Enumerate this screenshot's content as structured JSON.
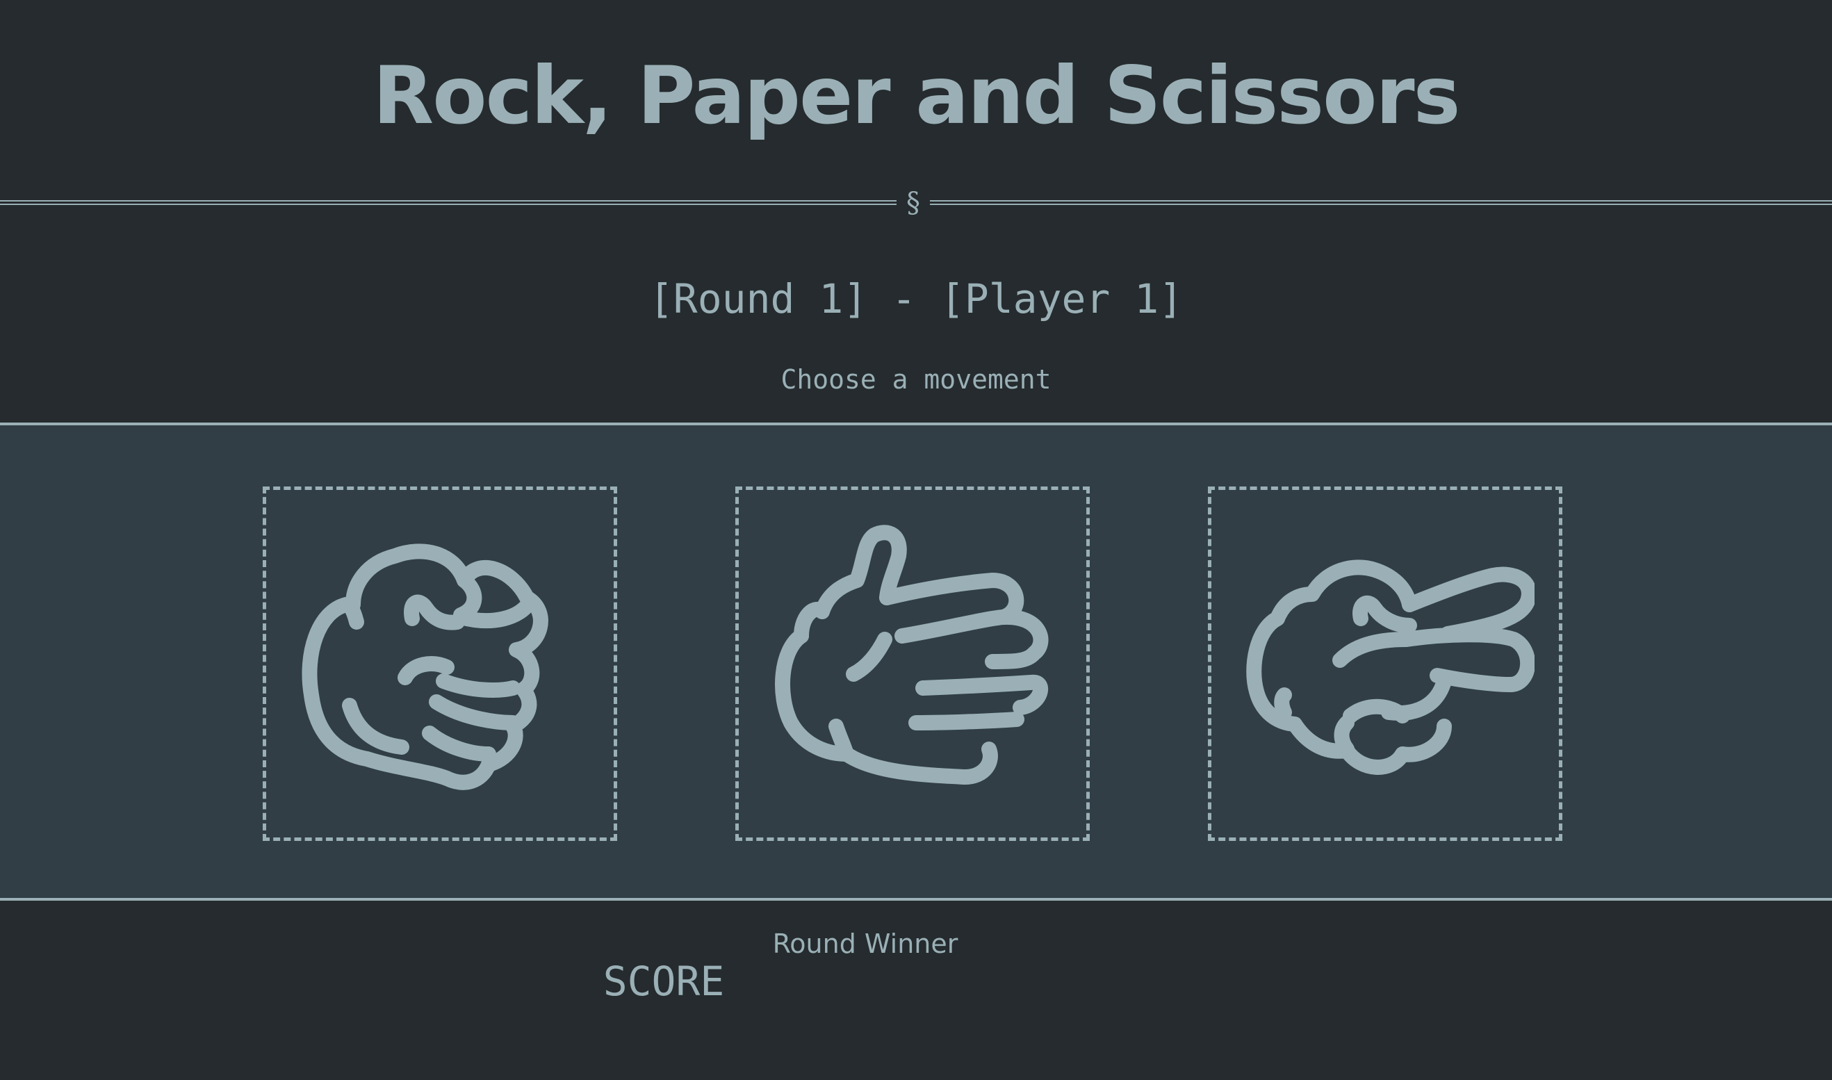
{
  "header": {
    "title": "Rock, Paper and Scissors",
    "divider_symbol": "§"
  },
  "round": {
    "info": "[Round 1] - [Player 1]",
    "instruction": "Choose a movement"
  },
  "choices": [
    {
      "name": "rock",
      "icon": "rock-hand-icon"
    },
    {
      "name": "paper",
      "icon": "paper-hand-icon"
    },
    {
      "name": "scissors",
      "icon": "scissors-hand-icon"
    }
  ],
  "footer": {
    "round_winner_label": "Round Winner",
    "score_label": "SCORE"
  },
  "colors": {
    "background": "#252b2e",
    "band": "#313e46",
    "accent": "#9ab0b6"
  }
}
